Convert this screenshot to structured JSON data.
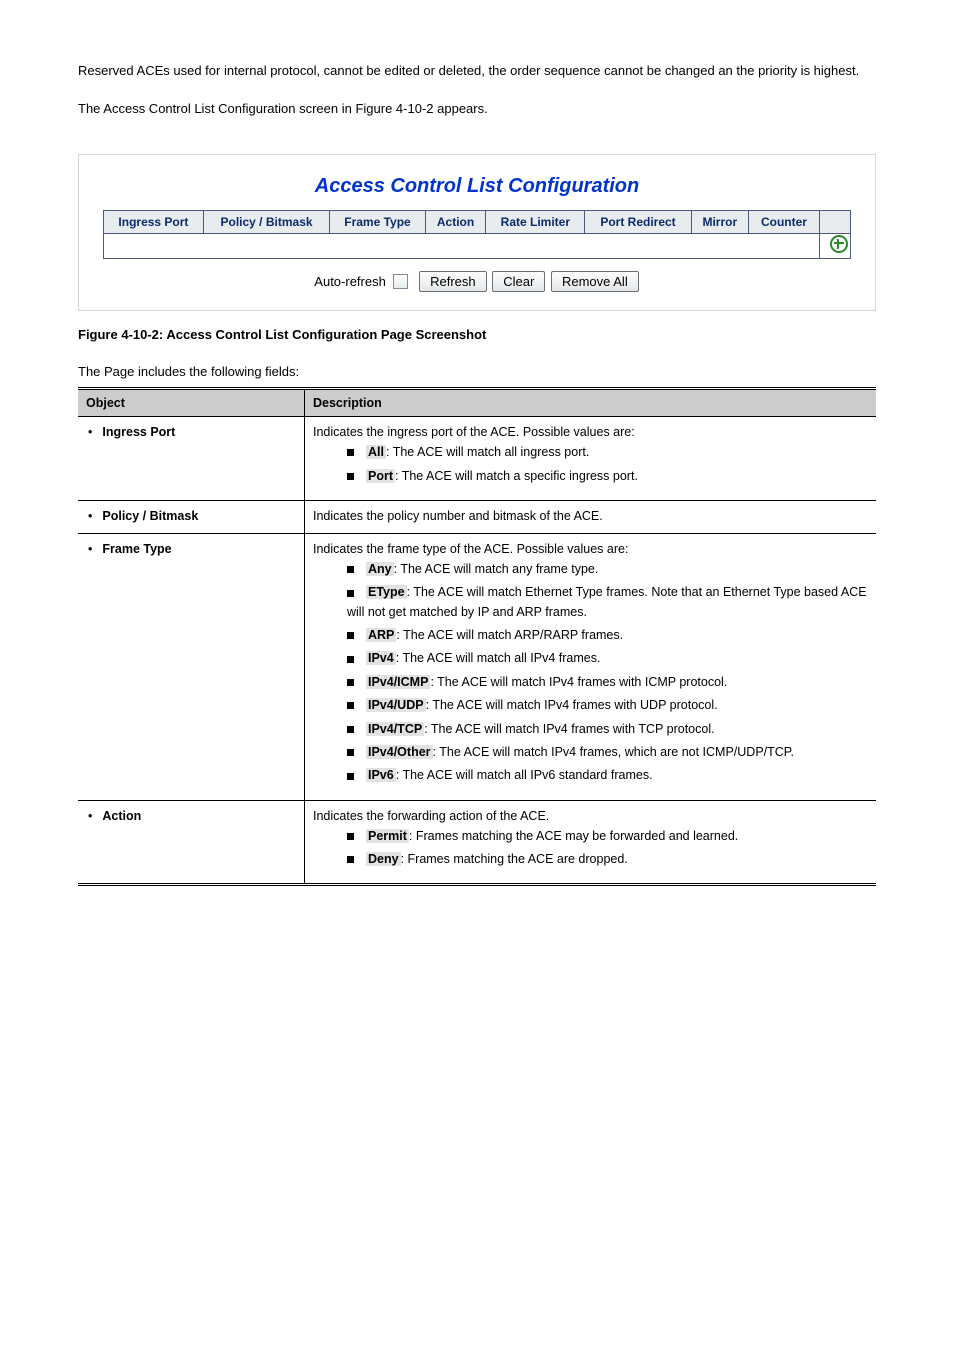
{
  "intro": {
    "p1_a": "Reserved ACEs used for internal protocol, cannot be edited or deleted, the order sequence cannot be changed an the priority is highest.",
    "p1_b": "The Access Control List Configuration screen in ",
    "p1_figref": "Figure 4-10-2",
    "p1_c": " appears."
  },
  "figure": {
    "title": "Access Control List Configuration",
    "headers": [
      "Ingress Port",
      "Policy / Bitmask",
      "Frame Type",
      "Action",
      "Rate Limiter",
      "Port Redirect",
      "Mirror",
      "Counter"
    ],
    "auto_refresh_label": "Auto-refresh",
    "btn_refresh": "Refresh",
    "btn_clear": "Clear",
    "btn_remove_all": "Remove All"
  },
  "caption_prefix": "Figure 4-10-2:",
  "caption_text": " Access Control List Configuration Page Screenshot",
  "subhead": "The Page includes the following fields:",
  "table_head": {
    "object": "Object",
    "description": "Description"
  },
  "rows": {
    "ingress": {
      "label": "Ingress Port",
      "lead": "Indicates the ingress port of the ACE. Possible values are:",
      "items": [
        {
          "k": "All",
          "t": ": The ACE will match all ingress port."
        },
        {
          "k": "Port",
          "t": ": The ACE will match a specific ingress port."
        }
      ]
    },
    "policy": {
      "label": "Policy / Bitmask",
      "lead": "Indicates the policy number and bitmask of the ACE."
    },
    "frame": {
      "label": "Frame Type",
      "lead1": "Indicates the frame type of the ACE. Possible values are:",
      "row_any": {
        "k": "Any",
        "t": ": The ACE will match any frame type."
      },
      "row_etype": {
        "k": "EType",
        "t": ": The ACE will match Ethernet Type frames. Note that an Ethernet Type based ACE will not get matched by IP and ARP frames."
      },
      "row_arp": {
        "k": "ARP",
        "t": ": The ACE will match ARP/RARP frames."
      },
      "row_ipv4": {
        "k": "IPv4",
        "t": ": The ACE will match all IPv4 frames."
      },
      "row_icmp": {
        "k": "IPv4/ICMP",
        "t": ": The ACE will match IPv4 frames with ICMP protocol."
      },
      "row_udp": {
        "k": "IPv4/UDP",
        "t": ": The ACE will match IPv4 frames with UDP protocol."
      },
      "row_tcp": {
        "k": "IPv4/TCP",
        "t": ": The ACE will match IPv4 frames with TCP protocol."
      },
      "row_other_a": {
        "k": "IPv4/Other",
        "t_a": ": The ACE will match IPv4 frames, which are not ICMP/UDP/TCP."
      },
      "row_ipv6": {
        "k": "IPv6",
        "t": ": The ACE will match all IPv6 standard frames."
      }
    },
    "action": {
      "label": "Action",
      "lead": "Indicates the forwarding action of the ACE.",
      "items": [
        {
          "k": "Permit",
          "t": ": Frames matching the ACE may be forwarded and learned."
        },
        {
          "k": "Deny",
          "t": ": Frames matching the ACE are dropped."
        }
      ]
    }
  }
}
